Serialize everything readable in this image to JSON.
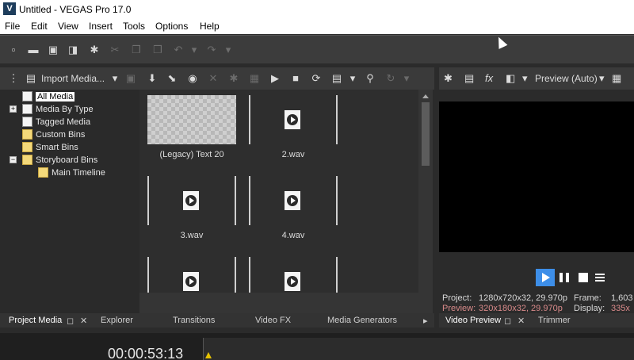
{
  "window": {
    "title": "Untitled - VEGAS Pro 17.0",
    "app_icon_glyph": "V"
  },
  "menu": [
    "File",
    "Edit",
    "View",
    "Insert",
    "Tools",
    "Options",
    "Help"
  ],
  "main_toolbar_icons": [
    "new-file-icon",
    "open-folder-icon",
    "save-icon",
    "render-icon",
    "settings-gear-icon",
    "cut-icon",
    "copy-icon",
    "paste-icon",
    "undo-icon",
    "redo-icon"
  ],
  "project_media": {
    "import_label": "Import Media...",
    "tree": [
      {
        "label": "All Media",
        "selected": true
      },
      {
        "label": "Media By Type",
        "expander": "+"
      },
      {
        "label": "Tagged Media"
      },
      {
        "label": "Custom Bins"
      },
      {
        "label": "Smart Bins"
      },
      {
        "label": "Storyboard Bins",
        "expander": "−"
      },
      {
        "label": "Main Timeline"
      }
    ],
    "items": [
      {
        "label": "(Legacy) Text 20"
      },
      {
        "label": "2.wav"
      },
      {
        "label": "3.wav"
      },
      {
        "label": "4.wav"
      }
    ]
  },
  "tabs_left": {
    "project_media": "Project Media",
    "explorer": "Explorer",
    "transitions": "Transitions",
    "video_fx": "Video FX",
    "media_generators": "Media Generators",
    "more_arrow": "▸"
  },
  "preview": {
    "fx_label": "fx",
    "mode_label": "Preview (Auto)",
    "project_label": "Project:",
    "project_value": "1280x720x32, 29.970p",
    "preview_label": "Preview:",
    "preview_value": "320x180x32, 29.970p",
    "frame_label": "Frame:",
    "frame_value": "1,603",
    "display_label": "Display:",
    "display_value": "335x",
    "accent_color": "#3d8ee8",
    "value_color": "#d98a8a"
  },
  "tabs_right": {
    "video_preview": "Video Preview",
    "trimmer": "Trimmer"
  },
  "timeline": {
    "timecode": "00:00:53:13"
  }
}
